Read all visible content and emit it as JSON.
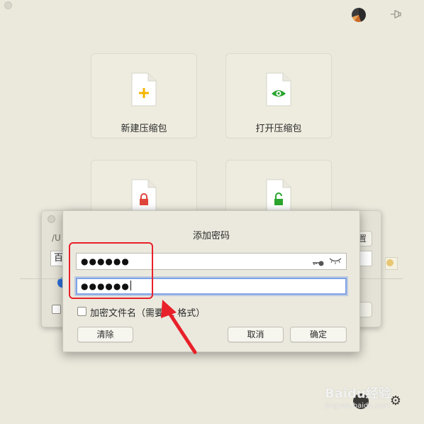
{
  "tiles": [
    {
      "label": "新建压缩包",
      "icon": "plus-file-icon",
      "accent": "#f4b400"
    },
    {
      "label": "打开压缩包",
      "icon": "eye-file-icon",
      "accent": "#2aa52e"
    },
    {
      "label": "",
      "icon": "lock-file-icon",
      "accent": "#e0453b"
    },
    {
      "label": "",
      "icon": "unlock-file-icon",
      "accent": "#2aa52e"
    }
  ],
  "bg_dialog": {
    "path": "/U",
    "field_char": "百",
    "right_button_char": "置"
  },
  "dialog": {
    "title": "添加密码",
    "password1_mask": "●●●●●●",
    "password2_mask": "●●●●●●",
    "encrypt_filenames_label": "加密文件名（需要7z 格式）",
    "clear_label": "清除",
    "cancel_label": "取消",
    "ok_label": "确定"
  },
  "watermark": {
    "brand": "Baidu经验",
    "url": "jingyan.baidu.com"
  },
  "colors": {
    "background": "#ebe9dc",
    "annotation_red": "#e8212a",
    "focus_blue": "#7fa3e6"
  }
}
